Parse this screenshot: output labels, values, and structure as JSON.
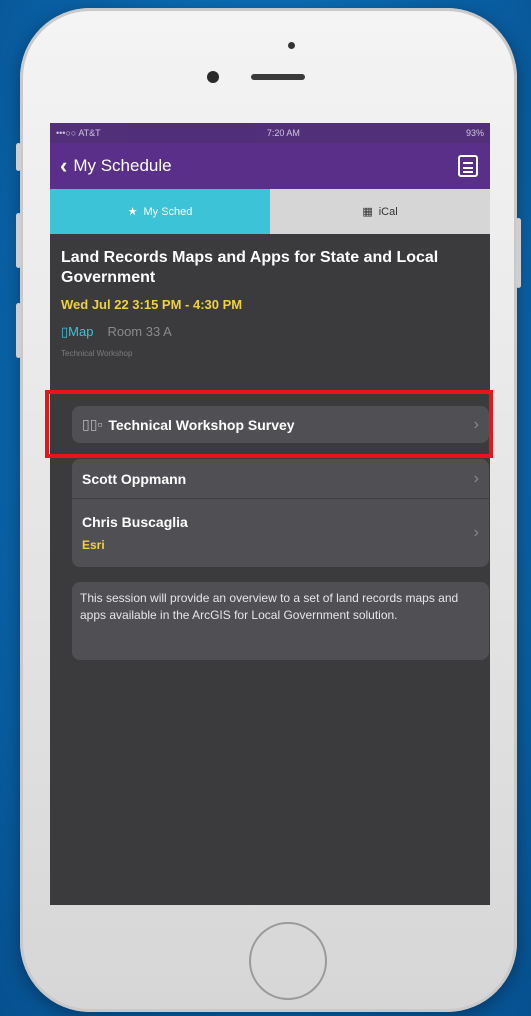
{
  "status_bar": {
    "carrier": "•••○○ AT&T",
    "time": "7:20 AM",
    "battery": "93%"
  },
  "nav": {
    "back_label": "My Schedule",
    "back_icon": "chevron-left-icon",
    "calendar_icon": "calendar-list-icon"
  },
  "tabs": [
    {
      "label": "My Sched",
      "icon": "★",
      "active": true
    },
    {
      "label": "iCal",
      "icon": "▦",
      "active": false
    }
  ],
  "session": {
    "title": "Land Records Maps and Apps for State and Local Government",
    "datetime": "Wed Jul 22 3:15 PM - 4:30 PM",
    "map_label": "Map",
    "room": "Room 33 A",
    "track": "Technical Workshop"
  },
  "survey": {
    "label": "Technical Workshop Survey",
    "icon": "bar-chart-icon"
  },
  "presenters": [
    {
      "name": "Scott Oppmann",
      "org": ""
    },
    {
      "name": "Chris Buscaglia",
      "org": "Esri"
    }
  ],
  "description": "This session will provide an overview to a set of land records maps and apps available in the ArcGIS for Local Government solution.",
  "colors": {
    "nav_purple": "#5a2f8a",
    "tab_active": "#3cc3d8",
    "accent_yellow": "#f0d23c",
    "highlight_red": "#e8141a"
  }
}
